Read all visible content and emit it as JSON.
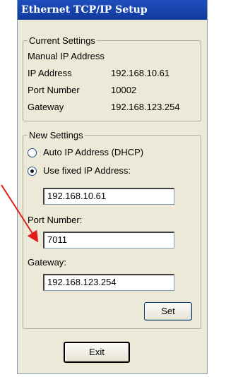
{
  "window": {
    "title": "Ethernet TCP/IP Setup"
  },
  "current_settings": {
    "legend": "Current Settings",
    "mode": "Manual IP Address",
    "ip_label": "IP Address",
    "ip_value": "192.168.10.61",
    "port_label": "Port Number",
    "port_value": "10002",
    "gateway_label": "Gateway",
    "gateway_value": "192.168.123.254"
  },
  "new_settings": {
    "legend": "New Settings",
    "auto_ip_label": "Auto IP Address (DHCP)",
    "auto_ip_selected": false,
    "fixed_ip_label": "Use fixed IP Address:",
    "fixed_ip_selected": true,
    "ip_value": "192.168.10.61",
    "port_label": "Port Number:",
    "port_value": "7011",
    "gateway_label": "Gateway:",
    "gateway_value": "192.168.123.254",
    "set_label": "Set"
  },
  "exit_label": "Exit",
  "colors": {
    "titlebar": "#1f4fbe",
    "dialog_bg": "#ece9d8",
    "annotation_arrow": "#e11b1b"
  }
}
